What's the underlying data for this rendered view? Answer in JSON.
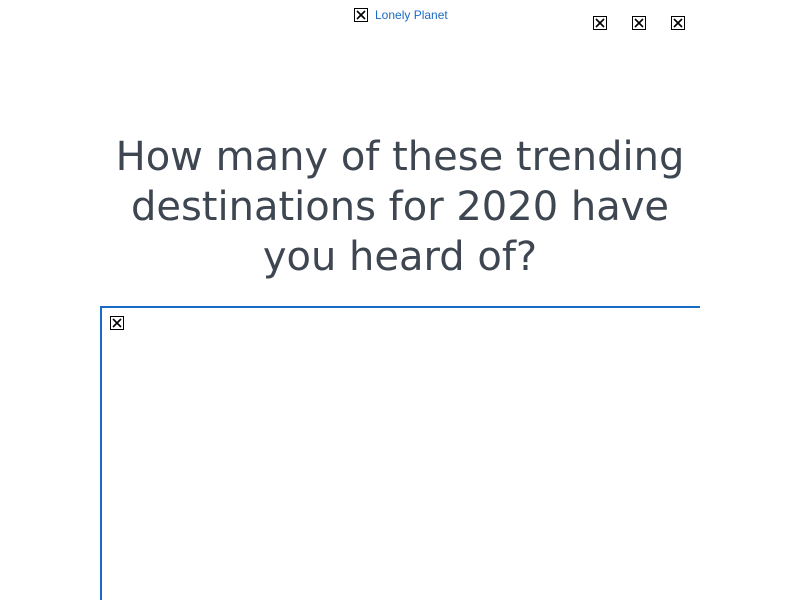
{
  "header": {
    "brand_label": "Lonely Planet",
    "brand_icon": "broken-image-icon",
    "share_icons": [
      "broken-image-icon",
      "broken-image-icon",
      "broken-image-icon"
    ]
  },
  "article": {
    "title": "How many of these trending destinations for 2020 have you heard of?",
    "hero_image_icon": "broken-image-icon"
  },
  "colors": {
    "link": "#1a6bc4",
    "title": "#3d4651",
    "frame_border": "#1a6bc4"
  }
}
